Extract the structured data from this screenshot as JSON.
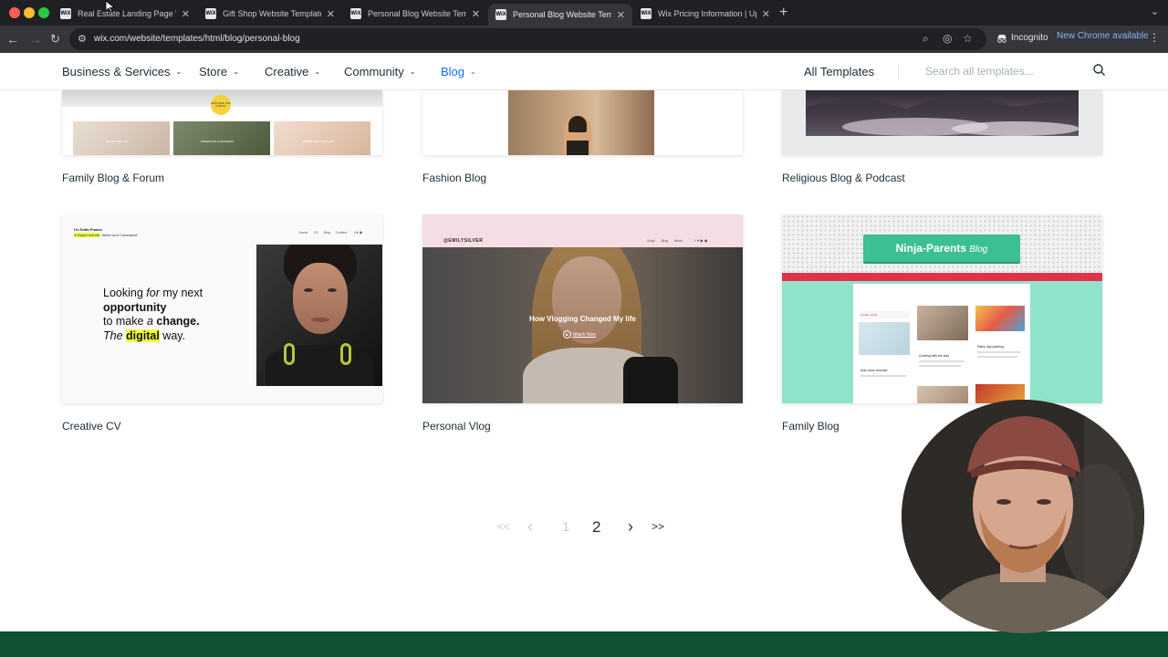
{
  "browser": {
    "tabs": [
      {
        "label": "Real Estate Landing Page We",
        "active": false
      },
      {
        "label": "Gift Shop Website Template |",
        "active": false
      },
      {
        "label": "Personal Blog Website Templ",
        "active": false
      },
      {
        "label": "Personal Blog Website Templ",
        "active": true
      },
      {
        "label": "Wix Pricing Information | Upg",
        "active": false
      }
    ],
    "favicon_text": "WiX",
    "url": "wix.com/website/templates/html/blog/personal-blog",
    "incognito_label": "Incognito",
    "update_label": "New Chrome available"
  },
  "nav": {
    "items": [
      "Business & Services",
      "Store",
      "Creative",
      "Community",
      "Blog"
    ],
    "active_item": "Blog",
    "all_templates": "All Templates",
    "search_placeholder": "Search all templates..."
  },
  "templates": {
    "row1": [
      "Family Blog & Forum",
      "Fashion Blog",
      "Religious Blog & Podcast"
    ],
    "row2": [
      "Creative CV",
      "Personal Vlog",
      "Family Blog"
    ]
  },
  "previews": {
    "cv": {
      "header_name": "I'm Sofia Franco",
      "header_sub_highlight": "A Digital Activist",
      "header_sub": ", Writer and Consultant.",
      "nav": [
        "Home",
        "CV",
        "Blog",
        "Contact"
      ],
      "line1_a": "Looking ",
      "line1_b": "for",
      "line1_c": " my next",
      "line2": "opportunity",
      "line3_a": "to make ",
      "line3_b": "a",
      "line3_c": " change.",
      "line4_a": "The ",
      "line4_b": "digital",
      "line4_c": " way."
    },
    "vlog": {
      "brand": "@EMILYSILVER",
      "nav": [
        "Vlogs",
        "Blog",
        "About"
      ],
      "headline": "How Vlogging Changed My life",
      "cta": "Watch Now"
    },
    "family": {
      "banner": "Ninja-Parents",
      "banner_script": "Blog",
      "create_post": "Create a Post",
      "posts": [
        "Kids room remodel",
        "Cooking with the kids",
        "Rainy day painting"
      ]
    },
    "fashion_badge": "EXPLORE THE FORUM",
    "forum_tiles": [
      "PARENTING TIPS",
      "PARENTING & BUSINESS",
      "PARENTING TODDLERS"
    ]
  },
  "pagination": {
    "first": "<<",
    "prev": "‹",
    "pages": [
      "1",
      "2"
    ],
    "current": "2",
    "next": "›",
    "last": ">>"
  },
  "colors": {
    "active_nav": "#116dff",
    "footer": "#0f5132",
    "ninja_banner": "#3cbf93",
    "ninja_stripe": "#e0334b",
    "ninja_bg": "#8fe3cb",
    "cv_highlight": "#f4ff3a"
  }
}
